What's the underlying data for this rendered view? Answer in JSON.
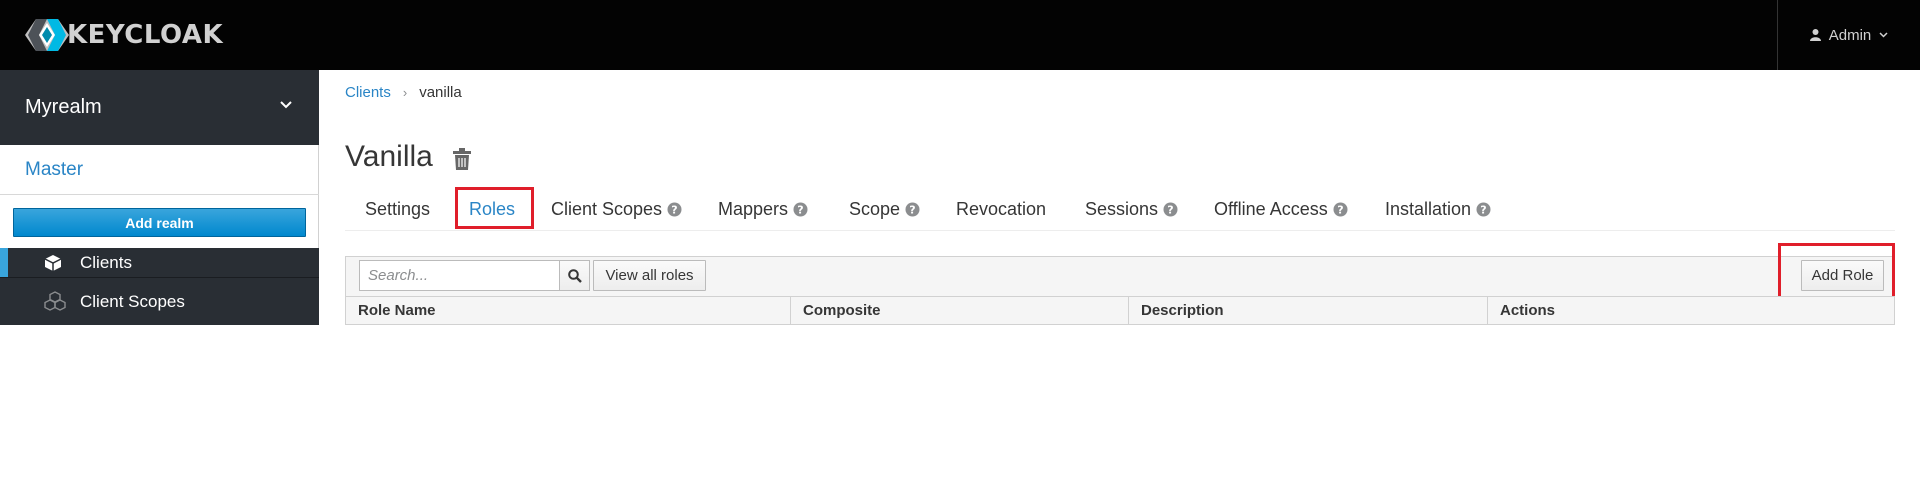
{
  "header": {
    "logo_text": "KEYCLOAK",
    "user_name": "Admin"
  },
  "sidebar": {
    "realm_selected": "Myrealm",
    "realm_options": [
      "Master"
    ],
    "add_realm_label": "Add realm",
    "items": [
      {
        "label": "Clients",
        "icon": "cube-icon",
        "active": true
      },
      {
        "label": "Client Scopes",
        "icon": "cubes-icon",
        "active": false
      }
    ]
  },
  "breadcrumb": {
    "parent": "Clients",
    "current": "vanilla"
  },
  "page": {
    "title": "Vanilla"
  },
  "tabs": [
    {
      "label": "Settings",
      "help": false
    },
    {
      "label": "Roles",
      "help": false,
      "active": true
    },
    {
      "label": "Client Scopes",
      "help": true
    },
    {
      "label": "Mappers",
      "help": true
    },
    {
      "label": "Scope",
      "help": true
    },
    {
      "label": "Revocation",
      "help": false
    },
    {
      "label": "Sessions",
      "help": true
    },
    {
      "label": "Offline Access",
      "help": true
    },
    {
      "label": "Installation",
      "help": true
    }
  ],
  "toolbar": {
    "search_placeholder": "Search...",
    "view_all_label": "View all roles",
    "add_role_label": "Add Role"
  },
  "table": {
    "columns": [
      "Role Name",
      "Composite",
      "Description",
      "Actions"
    ]
  },
  "colors": {
    "accent": "#2a85c6",
    "highlight": "#e01e2a",
    "navbar": "#030303",
    "sidebar_dark": "#292e34"
  }
}
